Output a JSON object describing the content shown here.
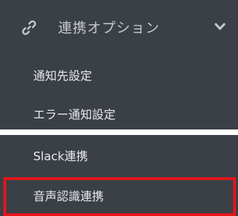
{
  "menu": {
    "header_label": "連携オプション",
    "header_icon": "link-icon",
    "expand_icon": "chevron-down-icon",
    "items": [
      {
        "label": "通知先設定"
      },
      {
        "label": "エラー通知設定"
      },
      {
        "label": "Slack連携"
      },
      {
        "label": "音声認識連携"
      }
    ]
  },
  "colors": {
    "background": "#3b4047",
    "header_text": "#c4c8cd",
    "item_text": "#e6e8ea",
    "highlight": "#e8141a",
    "gap": "#ffffff"
  }
}
